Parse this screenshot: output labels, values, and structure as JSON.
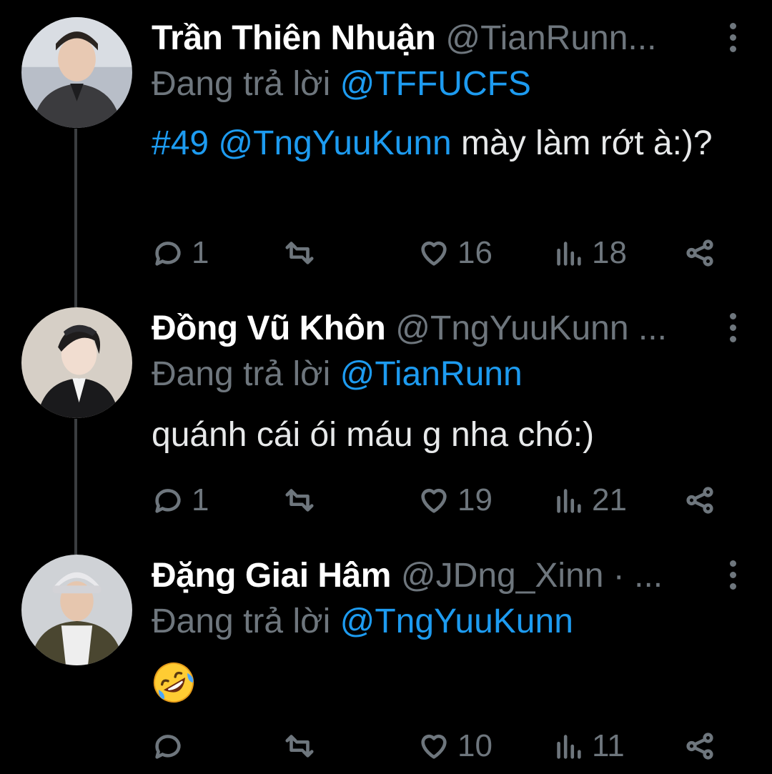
{
  "tweets": [
    {
      "name": "Trần Thiên Nhuận",
      "handle": "@TianRunn...",
      "reply_prefix": "Đang trả lời",
      "reply_to": "@TFFUCFS",
      "text_link": "#49 @TngYuuKunn",
      "text_rest": " mày làm rớt à:)?",
      "replies": "1",
      "retweets": "",
      "likes": "16",
      "views": "18",
      "avatar_icon": "profile-photo"
    },
    {
      "name": "Đồng Vũ Khôn",
      "handle": "@TngYuuKunn ...",
      "reply_prefix": "Đang trả lời",
      "reply_to": "@TianRunn",
      "text_link": "",
      "text_rest": "quánh cái ói máu g nha chó:)",
      "replies": "1",
      "retweets": "",
      "likes": "19",
      "views": "21",
      "avatar_icon": "profile-photo"
    },
    {
      "name": "Đặng Giai Hâm",
      "handle": "@JDng_Xinn · ...",
      "reply_prefix": "Đang trả lời",
      "reply_to": "@TngYuuKunn",
      "text_link": "",
      "text_rest": "",
      "emoji": "rolling-on-floor-laughing-emoji",
      "replies": "",
      "retweets": "",
      "likes": "10",
      "views": "11",
      "avatar_icon": "profile-photo"
    }
  ],
  "colors": {
    "background": "#000000",
    "name": "#ffffff",
    "muted": "#6e767d",
    "link": "#1d9bf0",
    "thread_line": "#3a3d40"
  }
}
